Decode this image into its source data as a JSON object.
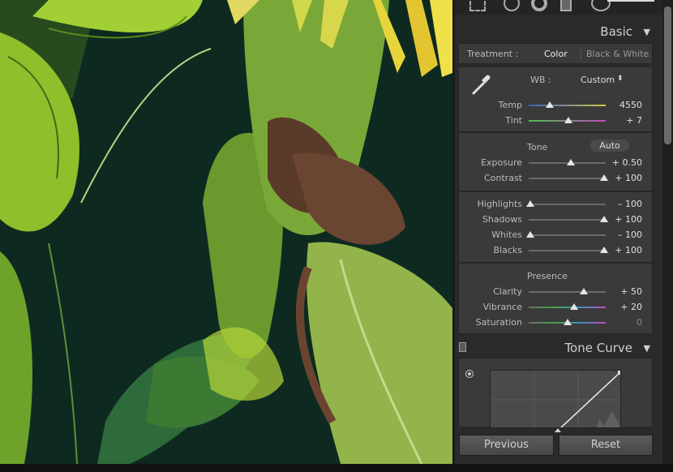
{
  "basic": {
    "title": "Basic",
    "treatment_label": "Treatment :",
    "treatment_color": "Color",
    "treatment_bw": "Black & White",
    "wb_label": "WB :",
    "wb_value": "Custom",
    "wb_arrows": "⬍",
    "temp": {
      "label": "Temp",
      "value": "4550",
      "position": 0.27
    },
    "tint": {
      "label": "Tint",
      "value": "+ 7",
      "position": 0.52
    },
    "tone_label": "Tone",
    "auto_label": "Auto",
    "exposure": {
      "label": "Exposure",
      "value": "+ 0.50",
      "position": 0.55
    },
    "contrast": {
      "label": "Contrast",
      "value": "+ 100",
      "position": 0.98
    },
    "highlights": {
      "label": "Highlights",
      "value": "– 100",
      "position": 0.02
    },
    "shadows": {
      "label": "Shadows",
      "value": "+ 100",
      "position": 0.98
    },
    "whites": {
      "label": "Whites",
      "value": "– 100",
      "position": 0.02
    },
    "blacks": {
      "label": "Blacks",
      "value": "+ 100",
      "position": 0.98
    },
    "presence_label": "Presence",
    "clarity": {
      "label": "Clarity",
      "value": "+ 50",
      "position": 0.72
    },
    "vibrance": {
      "label": "Vibrance",
      "value": "+ 20",
      "position": 0.59
    },
    "saturation": {
      "label": "Saturation",
      "value": "0",
      "position": 0.5
    }
  },
  "tone_curve": {
    "title": "Tone Curve"
  },
  "buttons": {
    "previous": "Previous",
    "reset": "Reset"
  },
  "icons": {
    "triangle": "▼"
  },
  "colors": {
    "panel_bg": "#2a2a2a",
    "box_bg": "#3a3a3a",
    "active_text": "#e6e6e6",
    "temp_start": "#3c5fbf",
    "temp_end": "#cfc64a",
    "tint_start": "#4cbf4c",
    "tint_end": "#bf4cbf"
  }
}
